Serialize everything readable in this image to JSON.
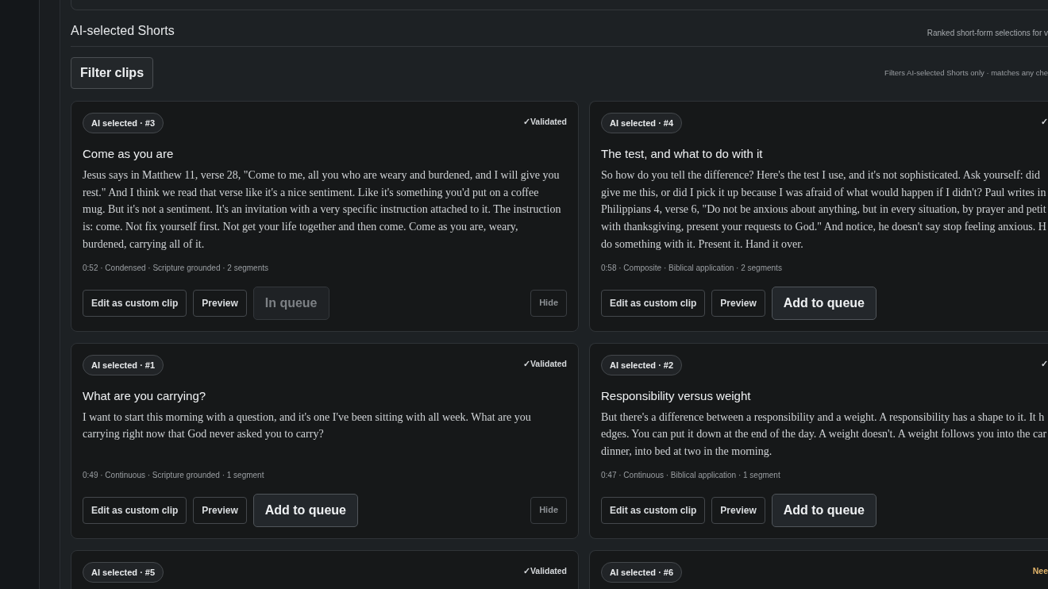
{
  "section": {
    "title": "AI-selected Shorts",
    "subtitle": "Ranked short-form selections for v"
  },
  "filter": {
    "button": "Filter clips",
    "note": "Filters AI-selected Shorts only · matches any che"
  },
  "clips": [
    {
      "badge": "AI selected · #3",
      "status": {
        "text": "✓Validated",
        "color": "#d6d9dc"
      },
      "title": "Come as you are",
      "body_lines": [
        "Jesus says in Matthew 11, verse 28, \"Come to me, all you who are weary and burdened, and I will give you",
        "rest.\" And I think we read that verse like it's a nice sentiment. Like it's something you'd put on a coffee",
        "mug. But it's not a sentiment. It's an invitation with a very specific instruction attached to it. The instruction",
        "is: come. Not fix yourself first. Not get your life together and then come. Come as you are, weary,",
        "burdened, carrying all of it."
      ],
      "meta": "0:52 · Condensed · Scripture grounded · 2 segments",
      "actions": [
        {
          "label": "Edit as custom clip",
          "kind": "secondary"
        },
        {
          "label": "Preview",
          "kind": "secondary"
        },
        {
          "label": "In queue",
          "kind": "queued"
        }
      ],
      "hide": "Hide"
    },
    {
      "badge": "AI selected · #4",
      "status": {
        "text": "✓",
        "color": "#d6d9dc"
      },
      "title": "The test, and what to do with it",
      "body_lines": [
        "So how do you tell the difference? Here's the test I use, and it's not sophisticated. Ask yourself: did",
        "give me this, or did I pick it up because I was afraid of what would happen if I didn't? Paul writes in",
        "Philippians 4, verse 6, \"Do not be anxious about anything, but in every situation, by prayer and petit",
        "with thanksgiving, present your requests to God.\" And notice, he doesn't say stop feeling anxious. H",
        "do something with it. Present it. Hand it over."
      ],
      "meta": "0:58 · Composite · Biblical application · 2 segments",
      "actions": [
        {
          "label": "Edit as custom clip",
          "kind": "secondary"
        },
        {
          "label": "Preview",
          "kind": "secondary"
        },
        {
          "label": "Add to queue",
          "kind": "primary"
        }
      ]
    },
    {
      "badge": "AI selected · #1",
      "status": {
        "text": "✓Validated",
        "color": "#d6d9dc"
      },
      "title": "What are you carrying?",
      "body_lines": [
        "I want to start this morning with a question, and it's one I've been sitting with all week. What are you",
        "carrying right now that God never asked you to carry?"
      ],
      "meta": "0:49 · Continuous · Scripture grounded · 1 segment",
      "actions": [
        {
          "label": "Edit as custom clip",
          "kind": "secondary"
        },
        {
          "label": "Preview",
          "kind": "secondary"
        },
        {
          "label": "Add to queue",
          "kind": "primary"
        }
      ],
      "hide": "Hide"
    },
    {
      "badge": "AI selected · #2",
      "status": {
        "text": "✓",
        "color": "#d6d9dc"
      },
      "title": "Responsibility versus weight",
      "body_lines": [
        "But there's a difference between a responsibility and a weight. A responsibility has a shape to it. It h",
        "edges. You can put it down at the end of the day. A weight doesn't. A weight follows you into the car",
        "dinner, into bed at two in the morning."
      ],
      "meta": "0:47 · Continuous · Biblical application · 1 segment",
      "actions": [
        {
          "label": "Edit as custom clip",
          "kind": "secondary"
        },
        {
          "label": "Preview",
          "kind": "secondary"
        },
        {
          "label": "Add to queue",
          "kind": "primary"
        }
      ]
    },
    {
      "badge": "AI selected · #5",
      "status": {
        "text": "✓Validated",
        "color": "#d6d9dc"
      }
    },
    {
      "badge": "AI selected · #6",
      "status": {
        "text": "Nee",
        "color": "#e2b46a"
      }
    }
  ]
}
